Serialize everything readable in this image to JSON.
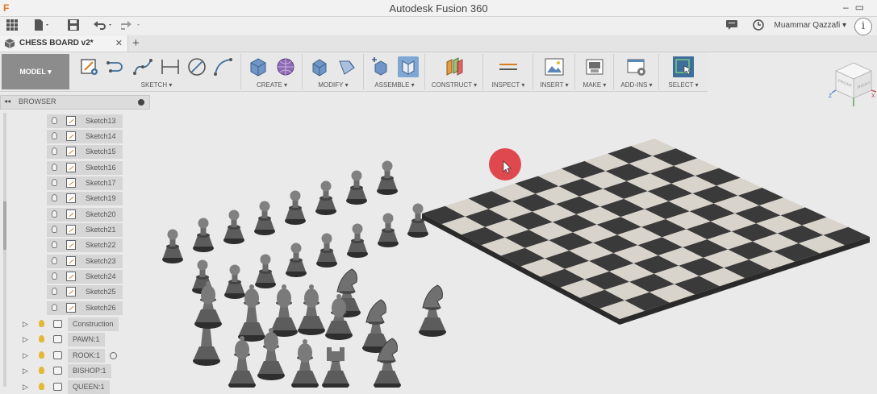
{
  "window": {
    "app_logo": "F",
    "title": "Autodesk Fusion 360",
    "controls": "–▭"
  },
  "quick_access": {
    "user_name": "Muammar Qazzafi ▾",
    "help_glyph": "i"
  },
  "document_tab": {
    "name": "CHESS BOARD v2*",
    "close": "✕",
    "new_tab": "+"
  },
  "toolbar": {
    "model_label": "MODEL ▾",
    "groups": [
      {
        "label": "SKETCH ▾"
      },
      {
        "label": "CREATE ▾"
      },
      {
        "label": "MODIFY ▾"
      },
      {
        "label": "ASSEMBLE ▾"
      },
      {
        "label": "CONSTRUCT ▾"
      },
      {
        "label": "INSPECT ▾"
      },
      {
        "label": "INSERT ▾"
      },
      {
        "label": "MAKE ▾"
      },
      {
        "label": "ADD-INS ▾"
      },
      {
        "label": "SELECT ▾"
      }
    ]
  },
  "browser": {
    "title": "BROWSER",
    "collapse": "◂◂",
    "sketches": [
      "Sketch13",
      "Sketch14",
      "Sketch15",
      "Sketch16",
      "Sketch17",
      "Sketch19",
      "Sketch20",
      "Sketch21",
      "Sketch22",
      "Sketch23",
      "Sketch24",
      "Sketch25",
      "Sketch26"
    ],
    "components": [
      "Construction",
      "PAWN:1",
      "ROOK:1",
      "BISHOP:1",
      "QUEEN:1"
    ]
  },
  "viewcube": {
    "front": "FRONT",
    "right": "RIGHT",
    "axis_z": "Z",
    "axis_x": "X"
  },
  "colors": {
    "dark_square": "#3a3a3a",
    "light_square": "#d8d3cb",
    "piece": "#5c5c5c",
    "cursor_marker": "#e0484f",
    "select_accent": "#3f6e9c"
  }
}
